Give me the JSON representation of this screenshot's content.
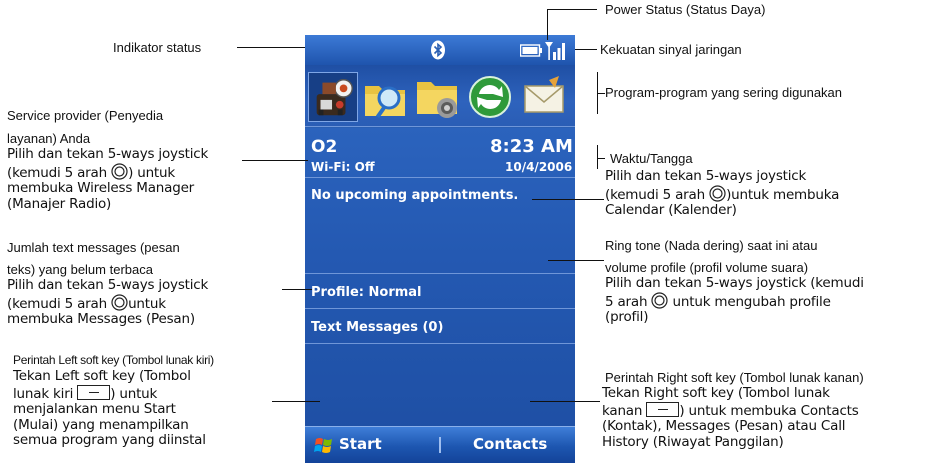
{
  "phone": {
    "carrier": "O2",
    "time": "8:23 AM",
    "wifi": "Wi-Fi: Off",
    "date": "10/4/2006",
    "appointments": "No upcoming appointments.",
    "profile": "Profile: Normal",
    "messages": "Text Messages (0)",
    "soft_left": "Start",
    "soft_right": "Contacts",
    "programs": [
      "games-icon",
      "search-icon",
      "file-explorer-icon",
      "activesync-icon",
      "messaging-icon"
    ]
  },
  "annotations": {
    "power": "Power Status (Status Daya)",
    "indicator": "Indikator status",
    "signal": "Kekuatan sinyal jaringan",
    "programs": "Program-program yang sering digunakan",
    "provider_1": "Service provider (Penyedia",
    "provider_2": "layanan) Anda",
    "provider_3a": "Pilih dan tekan 5-ways joystick",
    "provider_3b": "(kemudi 5 arah ",
    "provider_3c": ") untuk",
    "provider_3d": "membuka Wireless Manager",
    "provider_3e": "(Manajer Radio)",
    "time_1": "Waktu/Tangga",
    "time_2a": "Pilih dan tekan 5-ways joystick",
    "time_2b": "(kemudi 5 arah ",
    "time_2c": ")untuk membuka",
    "time_2d": "Calendar (Kalender)",
    "msg_1": "Jumlah text messages (pesan",
    "msg_2": "teks) yang belum terbaca",
    "msg_3a": "Pilih dan tekan 5-ways joystick",
    "msg_3b": "(kemudi 5 arah ",
    "msg_3c": "untuk",
    "msg_3d": "membuka Messages (Pesan)",
    "ring_1": "Ring tone (Nada dering) saat ini atau",
    "ring_2": "volume profile (profil volume suara)",
    "ring_3a": "Pilih dan tekan 5-ways joystick (kemudi",
    "ring_3b": "5 arah ",
    "ring_3c": " untuk mengubah profile",
    "ring_3d": "(profil)",
    "left_1": "Perintah Left soft key (Tombol lunak kiri)",
    "left_2a": "Tekan Left soft key (Tombol",
    "left_2b": "lunak kiri ",
    "left_2c": ") untuk",
    "left_2d": "menjalankan menu Start",
    "left_2e": "(Mulai) yang menampilkan",
    "left_2f": "semua program yang diinstal",
    "right_1": "Perintah Right soft key (Tombol lunak kanan)",
    "right_2a": "Tekan Right soft key (Tombol lunak",
    "right_2b": "kanan ",
    "right_2c": ") untuk membuka Contacts",
    "right_2d": "(Kontak), Messages (Pesan) atau Call",
    "right_2e": "History (Riwayat Panggilan)"
  }
}
